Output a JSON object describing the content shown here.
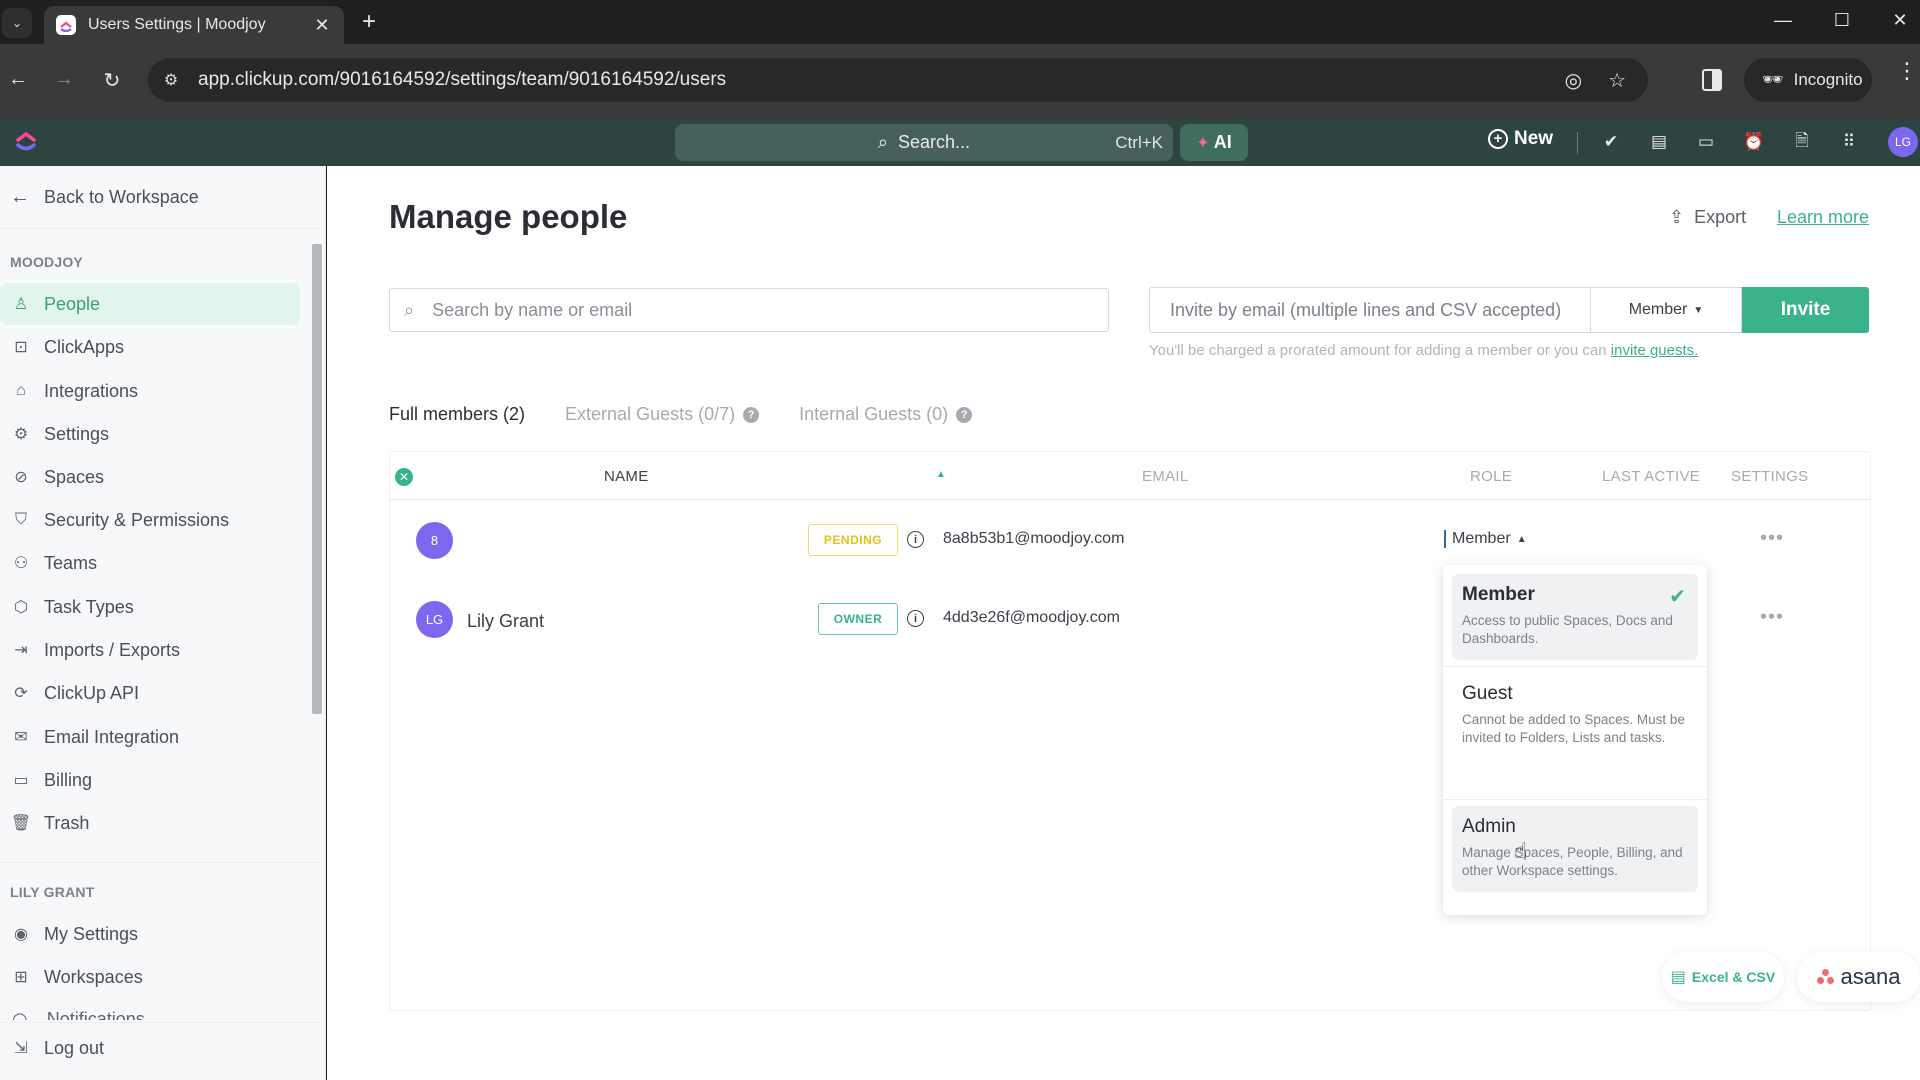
{
  "browser": {
    "tab_title": "Users Settings | Moodjoy",
    "url": "app.clickup.com/9016164592/settings/team/9016164592/users",
    "incognito_label": "Incognito"
  },
  "appbar": {
    "search_placeholder": "Search...",
    "search_shortcut": "Ctrl+K",
    "ai_label": "AI",
    "new_label": "New",
    "avatar_initials": "LG"
  },
  "sidebar": {
    "back_label": "Back to Workspace",
    "workspace_section": "MOODJOY",
    "workspace_items": [
      {
        "label": "People",
        "icon": "person-icon",
        "active": true
      },
      {
        "label": "ClickApps",
        "icon": "clickapps-icon"
      },
      {
        "label": "Integrations",
        "icon": "puzzle-icon"
      },
      {
        "label": "Settings",
        "icon": "gear-icon"
      },
      {
        "label": "Spaces",
        "icon": "planet-icon"
      },
      {
        "label": "Security & Permissions",
        "icon": "shield-icon"
      },
      {
        "label": "Teams",
        "icon": "team-icon"
      },
      {
        "label": "Task Types",
        "icon": "cube-icon"
      },
      {
        "label": "Imports / Exports",
        "icon": "import-icon"
      },
      {
        "label": "ClickUp API",
        "icon": "api-icon"
      },
      {
        "label": "Email Integration",
        "icon": "mail-icon"
      },
      {
        "label": "Billing",
        "icon": "card-icon"
      },
      {
        "label": "Trash",
        "icon": "trash-icon"
      }
    ],
    "user_section": "LILY GRANT",
    "user_items": [
      {
        "label": "My Settings",
        "icon": "user-circle-icon"
      },
      {
        "label": "Workspaces",
        "icon": "workspaces-icon"
      },
      {
        "label": "Notifications",
        "icon": "bell-icon"
      }
    ],
    "logout_label": "Log out"
  },
  "main": {
    "title": "Manage people",
    "export_label": "Export",
    "learn_more_label": "Learn more",
    "search_placeholder": "Search by name or email",
    "invite_placeholder": "Invite by email (multiple lines and CSV accepted)",
    "invite_role": "Member",
    "invite_button": "Invite",
    "invite_note": "You'll be charged a prorated amount for adding a member or you can ",
    "invite_note_link": "invite guests.",
    "tabs": [
      {
        "label": "Full members (2)",
        "active": true
      },
      {
        "label": "External Guests (0/7)",
        "help": true
      },
      {
        "label": "Internal Guests (0)",
        "help": true
      }
    ],
    "table": {
      "columns": [
        "NAME",
        "EMAIL",
        "ROLE",
        "LAST ACTIVE",
        "SETTINGS"
      ],
      "rows": [
        {
          "initials": "8",
          "name": "",
          "status": "PENDING",
          "email": "8a8b53b1@moodjoy.com",
          "role": "Member",
          "last_active": ""
        },
        {
          "initials": "LG",
          "name": "Lily Grant",
          "status": "OWNER",
          "email": "4dd3e26f@moodjoy.com",
          "role": "",
          "last_active": ""
        }
      ]
    },
    "role_dropdown": {
      "options": [
        {
          "title": "Member",
          "desc": "Access to public Spaces, Docs and Dashboards.",
          "selected": true
        },
        {
          "title": "Guest",
          "desc": "Cannot be added to Spaces. Must be invited to Folders, Lists and tasks."
        },
        {
          "title": "Admin",
          "desc": "Manage Spaces, People, Billing, and other Workspace settings.",
          "hovered": true
        }
      ]
    },
    "imports": {
      "excel_label": "Excel & CSV",
      "asana_label": "asana"
    }
  },
  "colors": {
    "accent": "#3bb38a",
    "avatar": "#7b68ee",
    "appbar": "#2d4440",
    "pending": "#e4c21b"
  }
}
